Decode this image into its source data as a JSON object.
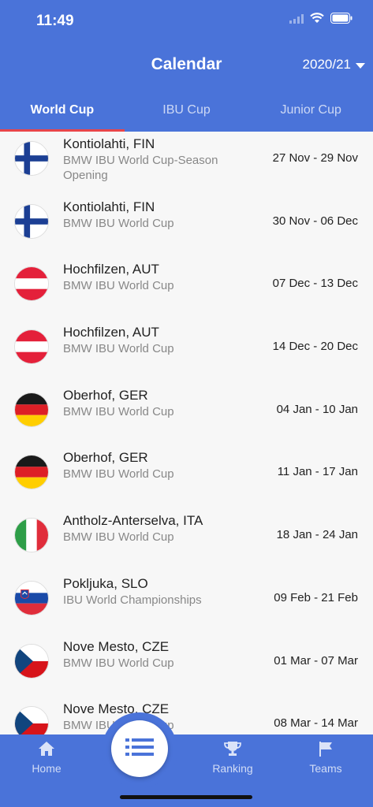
{
  "status": {
    "time": "11:49"
  },
  "header": {
    "title": "Calendar",
    "season": "2020/21"
  },
  "tabs": [
    {
      "label": "World Cup",
      "active": true
    },
    {
      "label": "IBU Cup",
      "active": false
    },
    {
      "label": "Junior Cup",
      "active": false
    }
  ],
  "events": [
    {
      "location": "Kontiolahti, FIN",
      "event": "BMW IBU World Cup-Season Opening",
      "dates": "27 Nov - 29 Nov",
      "flag": "FIN"
    },
    {
      "location": "Kontiolahti, FIN",
      "event": "BMW IBU World Cup",
      "dates": "30 Nov - 06 Dec",
      "flag": "FIN"
    },
    {
      "location": "Hochfilzen, AUT",
      "event": "BMW IBU World Cup",
      "dates": "07 Dec - 13 Dec",
      "flag": "AUT"
    },
    {
      "location": "Hochfilzen, AUT",
      "event": "BMW IBU World Cup",
      "dates": "14 Dec - 20 Dec",
      "flag": "AUT"
    },
    {
      "location": "Oberhof, GER",
      "event": "BMW IBU World Cup",
      "dates": "04 Jan - 10 Jan",
      "flag": "GER"
    },
    {
      "location": "Oberhof, GER",
      "event": "BMW IBU World Cup",
      "dates": "11 Jan - 17 Jan",
      "flag": "GER"
    },
    {
      "location": "Antholz-Anterselva, ITA",
      "event": "BMW IBU World Cup",
      "dates": "18 Jan - 24 Jan",
      "flag": "ITA"
    },
    {
      "location": "Pokljuka, SLO",
      "event": "IBU World Championships",
      "dates": "09 Feb - 21 Feb",
      "flag": "SLO"
    },
    {
      "location": "Nove Mesto, CZE",
      "event": "BMW IBU World Cup",
      "dates": "01 Mar - 07 Mar",
      "flag": "CZE"
    },
    {
      "location": "Nove Mesto, CZE",
      "event": "BMW IBU World Cup",
      "dates": "08 Mar - 14 Mar",
      "flag": "CZE"
    }
  ],
  "bottom_nav": {
    "home": "Home",
    "calendar_icon": "list-icon",
    "ranking": "Ranking",
    "teams": "Teams"
  },
  "colors": {
    "brand": "#4a73d9",
    "tab_indicator": "#e8454a"
  }
}
